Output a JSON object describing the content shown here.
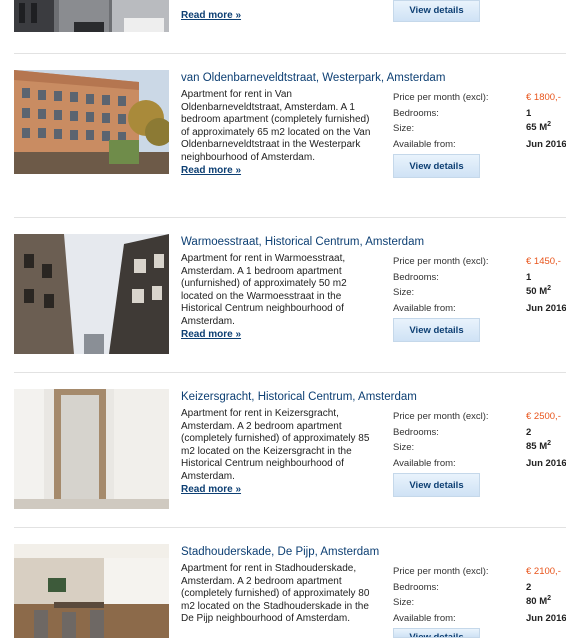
{
  "labels": {
    "price": "Price per month (excl):",
    "bedrooms": "Bedrooms:",
    "size": "Size:",
    "available": "Available from:",
    "view_details": "View details",
    "read_more": "Read more »"
  },
  "top": {
    "read_more": "Read more »",
    "view_details": "View details"
  },
  "listings": [
    {
      "title": "van Oldenbarneveldtstraat, Westerpark, Amsterdam",
      "description": "Apartment for rent in Van Oldenbarneveldtstraat, Amsterdam. A 1 bedroom apartment (completely furnished) of approximately 65 m2 located on the Van Oldenbarneveldtstraat in the Westerpark neighbourhood of Amsterdam.",
      "price": "€ 1800,-",
      "bedrooms": "1",
      "size": "65 M",
      "size_sup": "2",
      "available": "Jun 2016"
    },
    {
      "title": "Warmoesstraat, Historical Centrum, Amsterdam",
      "description": "Apartment for rent in Warmoesstraat, Amsterdam. A 1 bedroom apartment (unfurnished) of approximately 50 m2 located on the Warmoesstraat in the Historical Centrum neighbourhood of Amsterdam.",
      "price": "€ 1450,-",
      "bedrooms": "1",
      "size": "50 M",
      "size_sup": "2",
      "available": "Jun 2016"
    },
    {
      "title": "Keizersgracht, Historical Centrum, Amsterdam",
      "description": "Apartment for rent in Keizersgracht, Amsterdam. A 2 bedroom apartment (completely furnished) of approximately 85 m2 located on the Keizersgracht in the Historical Centrum neighbourhood of Amsterdam.",
      "price": "€ 2500,-",
      "bedrooms": "2",
      "size": "85 M",
      "size_sup": "2",
      "available": "Jun 2016"
    },
    {
      "title": "Stadhouderskade, De Pijp, Amsterdam",
      "description": "Apartment for rent in Stadhouderskade, Amsterdam. A 2 bedroom apartment (completely furnished) of approximately 80 m2 located on the Stadhouderskade in the De Pijp neighbourhood of Amsterdam.",
      "price": "€ 2100,-",
      "bedrooms": "2",
      "size": "80 M",
      "size_sup": "2",
      "available": "Jun 2016"
    }
  ]
}
